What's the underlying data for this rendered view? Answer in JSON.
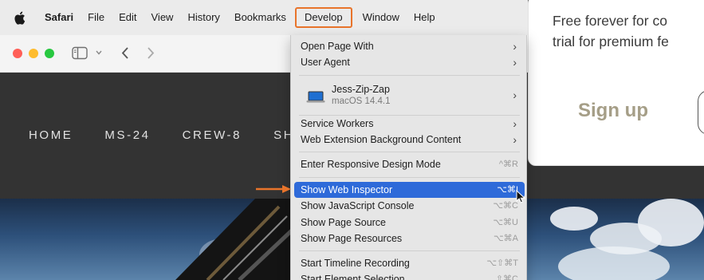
{
  "menubar": {
    "app_name": "Safari",
    "items": [
      "File",
      "Edit",
      "View",
      "History",
      "Bookmarks",
      "Develop",
      "Window",
      "Help"
    ],
    "active_item": "Develop",
    "highlight_color": "#e8742b"
  },
  "toolbar": {
    "traffic_lights": [
      "#ff5f57",
      "#febc2e",
      "#28c840"
    ],
    "icons": [
      "sidebar-icon",
      "chevron-down-icon",
      "back-icon",
      "forward-icon"
    ]
  },
  "site": {
    "nav": [
      "HOME",
      "MS-24",
      "CREW-8",
      "SHENZ"
    ]
  },
  "card": {
    "text_line1": "Free forever for co",
    "text_line2": "trial for premium fe",
    "signup_label": "Sign up"
  },
  "develop_menu": {
    "open_page_with": "Open Page With",
    "user_agent": "User Agent",
    "device_name": "Jess-Zip-Zap",
    "device_os": "macOS 14.4.1",
    "service_workers": "Service Workers",
    "web_extension_bg": "Web Extension Background Content",
    "responsive_mode": "Enter Responsive Design Mode",
    "responsive_shortcut": "^⌘R",
    "web_inspector": "Show Web Inspector",
    "web_inspector_shortcut": "⌥⌘I",
    "js_console": "Show JavaScript Console",
    "js_console_shortcut": "⌥⌘C",
    "page_source": "Show Page Source",
    "page_source_shortcut": "⌥⌘U",
    "page_resources": "Show Page Resources",
    "page_resources_shortcut": "⌥⌘A",
    "timeline": "Start Timeline Recording",
    "timeline_shortcut": "⌥⇧⌘T",
    "element_selection": "Start Element Selection",
    "element_selection_shortcut": "⇧⌘C",
    "selected_color": "#2e6ad9"
  }
}
